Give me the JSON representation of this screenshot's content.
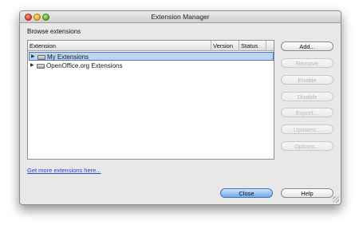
{
  "window": {
    "title": "Extension Manager"
  },
  "section_label": "Browse extensions",
  "table": {
    "columns": [
      "Extension",
      "Version",
      "Status"
    ],
    "rows": [
      {
        "label": "My Extensions",
        "selected": true
      },
      {
        "label": "OpenOffice.org Extensions",
        "selected": false
      }
    ]
  },
  "side_buttons": {
    "add": "Add...",
    "remove": "Remove",
    "enable": "Enable",
    "disable": "Disable",
    "export": "Export...",
    "updates": "Updates...",
    "options": "Options..."
  },
  "link": "Get more extensions here...",
  "bottom_buttons": {
    "close": "Close",
    "help": "Help"
  },
  "icons": {
    "close_window": "close-window-icon",
    "minimize_window": "minimize-window-icon",
    "maximize_window": "maximize-window-icon",
    "expand": "expand-triangle-icon",
    "folder": "folder-icon",
    "resize": "resize-grip-icon"
  },
  "colors": {
    "selection": "#bdd4f1",
    "link": "#2b44c9",
    "default_button": "#6fa8ea"
  }
}
